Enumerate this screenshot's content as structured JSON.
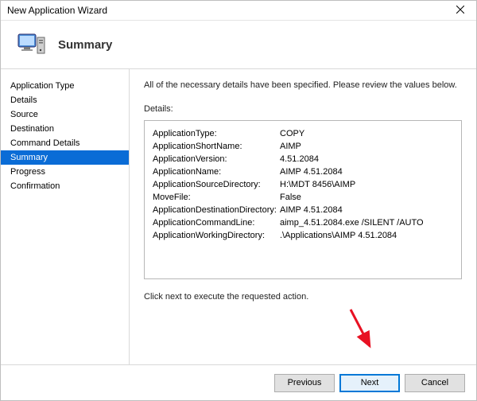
{
  "window": {
    "title": "New Application Wizard"
  },
  "header": {
    "title": "Summary"
  },
  "sidebar": {
    "items": [
      {
        "label": "Application Type",
        "selected": false
      },
      {
        "label": "Details",
        "selected": false
      },
      {
        "label": "Source",
        "selected": false
      },
      {
        "label": "Destination",
        "selected": false
      },
      {
        "label": "Command Details",
        "selected": false
      },
      {
        "label": "Summary",
        "selected": true
      },
      {
        "label": "Progress",
        "selected": false
      },
      {
        "label": "Confirmation",
        "selected": false
      }
    ]
  },
  "content": {
    "intro": "All of the necessary details have been specified.  Please review the values below.",
    "details_label": "Details:",
    "kv": [
      {
        "key": "ApplicationType:",
        "val": "COPY"
      },
      {
        "key": "ApplicationShortName:",
        "val": "AIMP"
      },
      {
        "key": "ApplicationVersion:",
        "val": "4.51.2084"
      },
      {
        "key": "ApplicationName:",
        "val": "AIMP 4.51.2084"
      },
      {
        "key": "ApplicationSourceDirectory:",
        "val": "H:\\MDT 8456\\AIMP"
      },
      {
        "key": "MoveFile:",
        "val": "False"
      },
      {
        "key": "ApplicationDestinationDirectory:",
        "val": "AIMP 4.51.2084"
      },
      {
        "key": "ApplicationCommandLine:",
        "val": "aimp_4.51.2084.exe /SILENT /AUTO"
      },
      {
        "key": "ApplicationWorkingDirectory:",
        "val": ".\\Applications\\AIMP 4.51.2084"
      }
    ],
    "footnote": "Click next to execute the requested action."
  },
  "footer": {
    "previous": "Previous",
    "next": "Next",
    "cancel": "Cancel"
  }
}
